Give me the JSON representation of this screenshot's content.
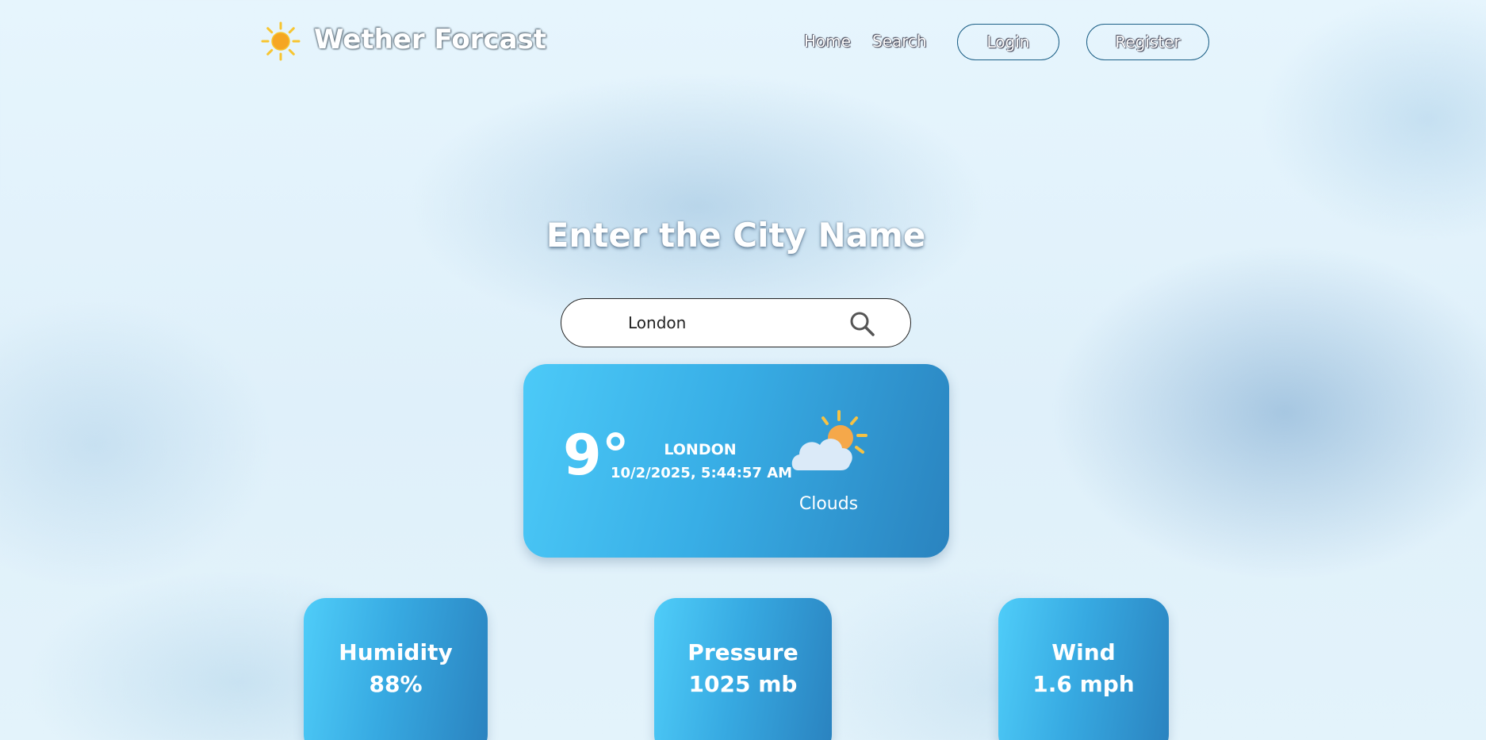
{
  "navbar": {
    "brand_title": "Wether Forcast",
    "brand_icon": "sun-icon",
    "links": [
      "Home",
      "Search"
    ],
    "login_label": "Login",
    "register_label": "Register"
  },
  "heading": "Enter the City Name",
  "search": {
    "value": "London",
    "icon": "search-icon"
  },
  "weather": {
    "temperature": "9°",
    "city": "LONDON",
    "datetime": "10/2/2025, 5:44:57 AM",
    "condition": "Clouds",
    "condition_icon": "partly-cloudy-icon"
  },
  "stats": [
    {
      "label": "Humidity",
      "value": "88%"
    },
    {
      "label": "Pressure",
      "value": "1025 mb"
    },
    {
      "label": "Wind",
      "value": "1.6 mph"
    }
  ],
  "colors": {
    "card_light": "#4ccaf8",
    "card_dark": "#2a83bf",
    "button_border": "#1c5f86",
    "sun": "#f5a623"
  }
}
